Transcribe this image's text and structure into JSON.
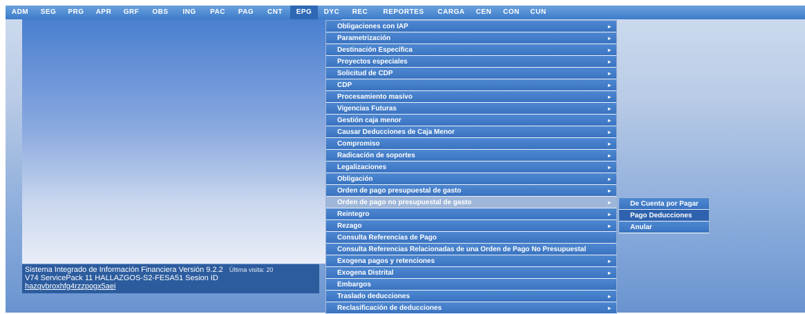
{
  "topbar": {
    "items": [
      {
        "label": "ADM",
        "w": 42
      },
      {
        "label": "SEG",
        "w": 40
      },
      {
        "label": "PRG",
        "w": 40
      },
      {
        "label": "APR",
        "w": 40
      },
      {
        "label": "GRF",
        "w": 40
      },
      {
        "label": "OBS",
        "w": 44
      },
      {
        "label": "ING",
        "w": 40
      },
      {
        "label": "PAC",
        "w": 42
      },
      {
        "label": "PAG",
        "w": 40
      },
      {
        "label": "CNT",
        "w": 44
      },
      {
        "label": "EPG",
        "w": 40,
        "active": true
      },
      {
        "label": "DYC",
        "w": 40
      },
      {
        "label": "REC",
        "w": 42
      },
      {
        "label": "REPORTES",
        "w": 84
      },
      {
        "label": "CARGA",
        "w": 54
      },
      {
        "label": "CEN",
        "w": 40
      },
      {
        "label": "CON",
        "w": 40
      },
      {
        "label": "CUN",
        "w": 38
      }
    ]
  },
  "footer": {
    "line1": "Sistema Integrado de Información Financiera Versión 9.2.2",
    "last_visit": "Última visita: 20",
    "line2": "V74 ServicePack 11 HALLAZGOS-S2-FESA51 Sesion ID",
    "session_id": "hazqvbroxhfg4rzzpogx5aei"
  },
  "menu": {
    "items": [
      {
        "label": "Obligaciones con IAP",
        "arrow": true
      },
      {
        "label": "Parametrización",
        "arrow": true
      },
      {
        "label": "Destinación Específica",
        "arrow": true
      },
      {
        "label": "Proyectos especiales",
        "arrow": true
      },
      {
        "label": "Solicitud de CDP",
        "arrow": true
      },
      {
        "label": "CDP",
        "arrow": true
      },
      {
        "label": "Procesamiento masivo",
        "arrow": true
      },
      {
        "label": "Vigencias Futuras",
        "arrow": true
      },
      {
        "label": "Gestión caja menor",
        "arrow": true
      },
      {
        "label": "Causar Deducciones de Caja Menor",
        "arrow": true
      },
      {
        "label": "Compromiso",
        "arrow": true
      },
      {
        "label": "Radicación de soportes",
        "arrow": true
      },
      {
        "label": "Legalizaciones",
        "arrow": true
      },
      {
        "label": "Obligación",
        "arrow": true
      },
      {
        "label": "Orden de pago presupuestal de gasto",
        "arrow": true
      },
      {
        "label": "Orden de pago no presupuestal de gasto",
        "arrow": true,
        "highlighted": true
      },
      {
        "label": "Reintegro",
        "arrow": true
      },
      {
        "label": "Rezago",
        "arrow": true
      },
      {
        "label": "Consulta Referencias de Pago",
        "arrow": false
      },
      {
        "label": "Consulta Referencias Relacionadas de una Orden de Pago No Presupuestal",
        "arrow": false
      },
      {
        "label": "Exogena pagos y retenciones",
        "arrow": true
      },
      {
        "label": "Exogena Distrital",
        "arrow": true
      },
      {
        "label": "Embargos",
        "arrow": false
      },
      {
        "label": "Traslado deducciones",
        "arrow": true
      },
      {
        "label": "Reclasificación de deducciones",
        "arrow": true
      }
    ]
  },
  "submenu": {
    "items": [
      {
        "label": "De Cuenta por Pagar"
      },
      {
        "label": "Pago Deducciones",
        "selected": true
      },
      {
        "label": "Anular"
      }
    ]
  },
  "icons": {
    "arrow": "▸"
  }
}
